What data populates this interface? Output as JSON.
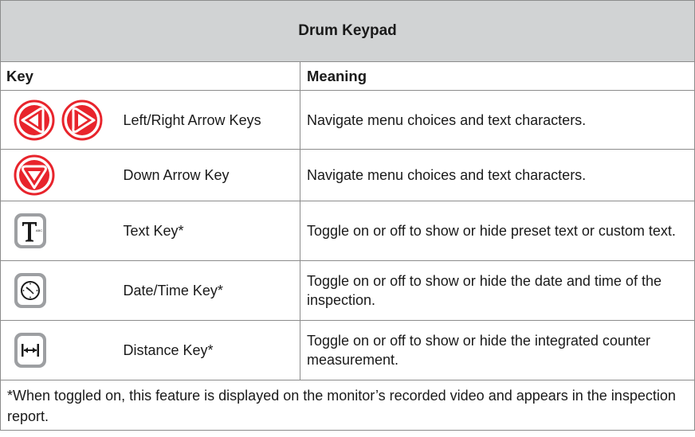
{
  "title": "Drum Keypad",
  "columns": {
    "key": "Key",
    "meaning": "Meaning"
  },
  "rows": [
    {
      "icons": [
        "left-arrow-key-icon",
        "right-arrow-key-icon"
      ],
      "key": "Left/Right Arrow Keys",
      "meaning": "Navigate menu choices and text characters."
    },
    {
      "icons": [
        "down-arrow-key-icon"
      ],
      "key": "Down Arrow Key",
      "meaning": "Navigate menu choices and text characters."
    },
    {
      "icons": [
        "text-key-icon"
      ],
      "key": "Text Key*",
      "meaning": "Toggle on or off to show or hide preset text or custom text."
    },
    {
      "icons": [
        "clock-key-icon"
      ],
      "key": "Date/Time Key*",
      "meaning": "Toggle on or off to show or hide the date and time of the inspection."
    },
    {
      "icons": [
        "distance-key-icon"
      ],
      "key": "Distance Key*",
      "meaning": "Toggle on or off to show or hide the integrated counter measurement."
    }
  ],
  "text_key_small_label": "ABC",
  "footnote": "*When toggled on, this feature is displayed on the monitor’s recorded video and appears in the inspection report.",
  "colors": {
    "header_bg": "#d1d3d4",
    "arrow_red": "#e8242c",
    "key_gray": "#9d9fa2"
  }
}
